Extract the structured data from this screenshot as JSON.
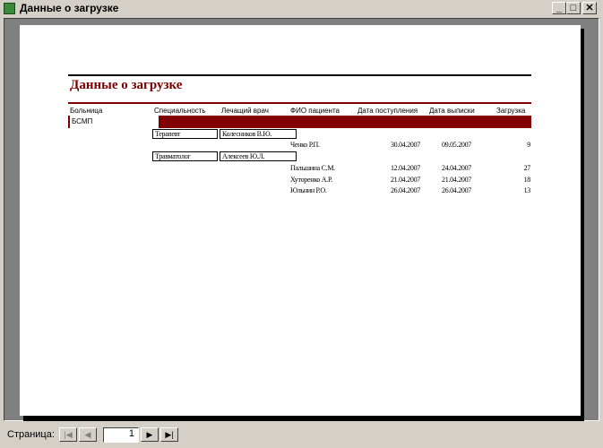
{
  "window": {
    "title": "Данные о загрузке",
    "minimize": "_",
    "maximize": "□",
    "close": "✕"
  },
  "report": {
    "title": "Данные о загрузке",
    "headers": [
      "Больница",
      "Специальность",
      "Лечащий врач",
      "ФИО пациента",
      "Дата поступления",
      "Дата выписки",
      "Загрузка"
    ],
    "hospital": "БСМП",
    "groups": [
      {
        "specialty": "Терапевт",
        "doctor": "Колесников В.Ю.",
        "rows": [
          {
            "patient": "Ченко Р.П.",
            "admitted": "30.04.2007",
            "discharged": "09.05.2007",
            "load": "9"
          }
        ]
      },
      {
        "specialty": "Травматолог",
        "doctor": "Алексеев Ю.Л.",
        "rows": [
          {
            "patient": "Пальшина С.М.",
            "admitted": "12.04.2007",
            "discharged": "24.04.2007",
            "load": "27"
          },
          {
            "patient": "Хуторенко А.Р.",
            "admitted": "21.04.2007",
            "discharged": "21.04.2007",
            "load": "18"
          },
          {
            "patient": "Юльнин Р.О.",
            "admitted": "26.04.2007",
            "discharged": "26.04.2007",
            "load": "13"
          }
        ]
      }
    ]
  },
  "navigator": {
    "label": "Страница:",
    "page": "1",
    "first": "|◀",
    "prev": "◀",
    "next": "▶",
    "last": "▶|"
  }
}
